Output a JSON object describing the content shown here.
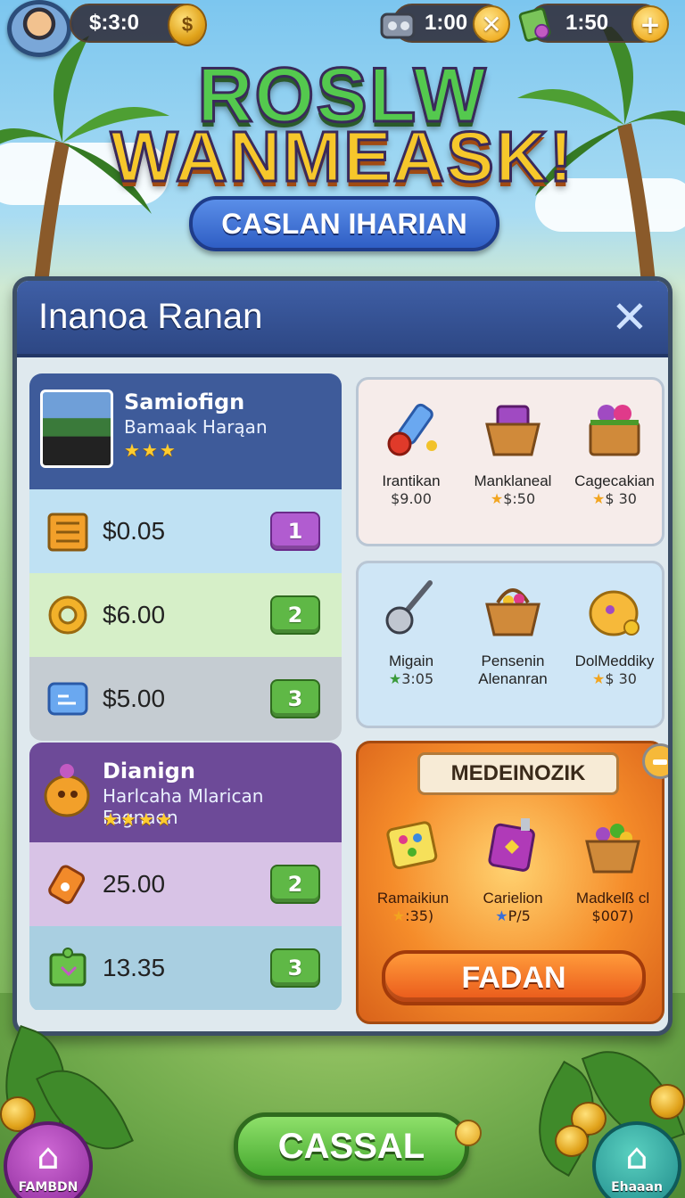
{
  "hud": {
    "money_value": "$:3:0",
    "timer1_value": "1:00",
    "timer1_button_glyph": "✕",
    "timer2_value": "1:50",
    "timer2_button_glyph": "+"
  },
  "title": {
    "line1": "ROSLW",
    "line2": "WANMEASK!",
    "banner": "CASLAN IHARIAN"
  },
  "panel": {
    "title": "Inanoa Ranan",
    "close_glyph": "✕"
  },
  "left_cards": [
    {
      "name": "Samiofign",
      "subtitle": "Bamaak Harąan",
      "stars": "★★★",
      "header_color": "#3e5b9a",
      "rows": [
        {
          "icon": "crate-icon",
          "amount": "$0.05",
          "number": "1",
          "bg": "#bfe1f3",
          "badge": "purple"
        },
        {
          "icon": "gear-icon",
          "amount": "$6.00",
          "number": "2",
          "bg": "#d6efc8",
          "badge": "green"
        },
        {
          "icon": "card-icon",
          "amount": "$5.00",
          "number": "3",
          "bg": "#c5ccd2",
          "badge": "green"
        }
      ]
    },
    {
      "name": "Dianign",
      "subtitle": "Harlcaha Mlarican Fagnaen",
      "stars": "★★★★",
      "header_color": "#6d4a98",
      "rows": [
        {
          "icon": "ticket-icon",
          "amount": "25.00",
          "number": "2",
          "bg": "#d8c3e6",
          "badge": "green"
        },
        {
          "icon": "cube-icon",
          "amount": "13.35",
          "number": "3",
          "bg": "#a9cfe1",
          "badge": "green"
        }
      ]
    }
  ],
  "shop_box1": {
    "items": [
      {
        "icon": "flashlight-icon",
        "label": "Irantikan",
        "price_star": "",
        "price": "$9.00"
      },
      {
        "icon": "basket-icon",
        "label": "Manklaneal",
        "price_star": "★",
        "price": "$:50"
      },
      {
        "icon": "gift-box-icon",
        "label": "Cagecakian",
        "price_star": "★",
        "price": "$ 30"
      }
    ]
  },
  "shop_box2": {
    "items": [
      {
        "icon": "wrench-icon",
        "label": "Migain",
        "price_star": "★",
        "price": "3:05"
      },
      {
        "icon": "picnic-basket-icon",
        "label": "Pensenin Alenanran",
        "price_star": "",
        "price": ""
      },
      {
        "icon": "blob-creature-icon",
        "label": "DolMeddiky",
        "price_star": "★",
        "price": "$ 30"
      }
    ]
  },
  "featured": {
    "ribbon": "MEDEINOZIK",
    "items": [
      {
        "icon": "puzzle-cube-icon",
        "label": "Ramaikiun",
        "price_star": "★",
        "price": ":35)"
      },
      {
        "icon": "potion-box-icon",
        "label": "Carielion",
        "price_star": "★",
        "price": "P/5"
      },
      {
        "icon": "fruit-basket-icon",
        "label": "Madkelß cl",
        "price_star": "",
        "price": "$007)"
      }
    ],
    "buy_label": "FADAN"
  },
  "bottom": {
    "cancel_label": "CASSAL",
    "home_label": "FAMBDN",
    "shop_label": "Ehaaan"
  },
  "colors": {
    "panel_header": "#3f5fa6",
    "accent_orange": "#f58c2a",
    "accent_green": "#5fb846",
    "accent_purple": "#b15cd0"
  }
}
